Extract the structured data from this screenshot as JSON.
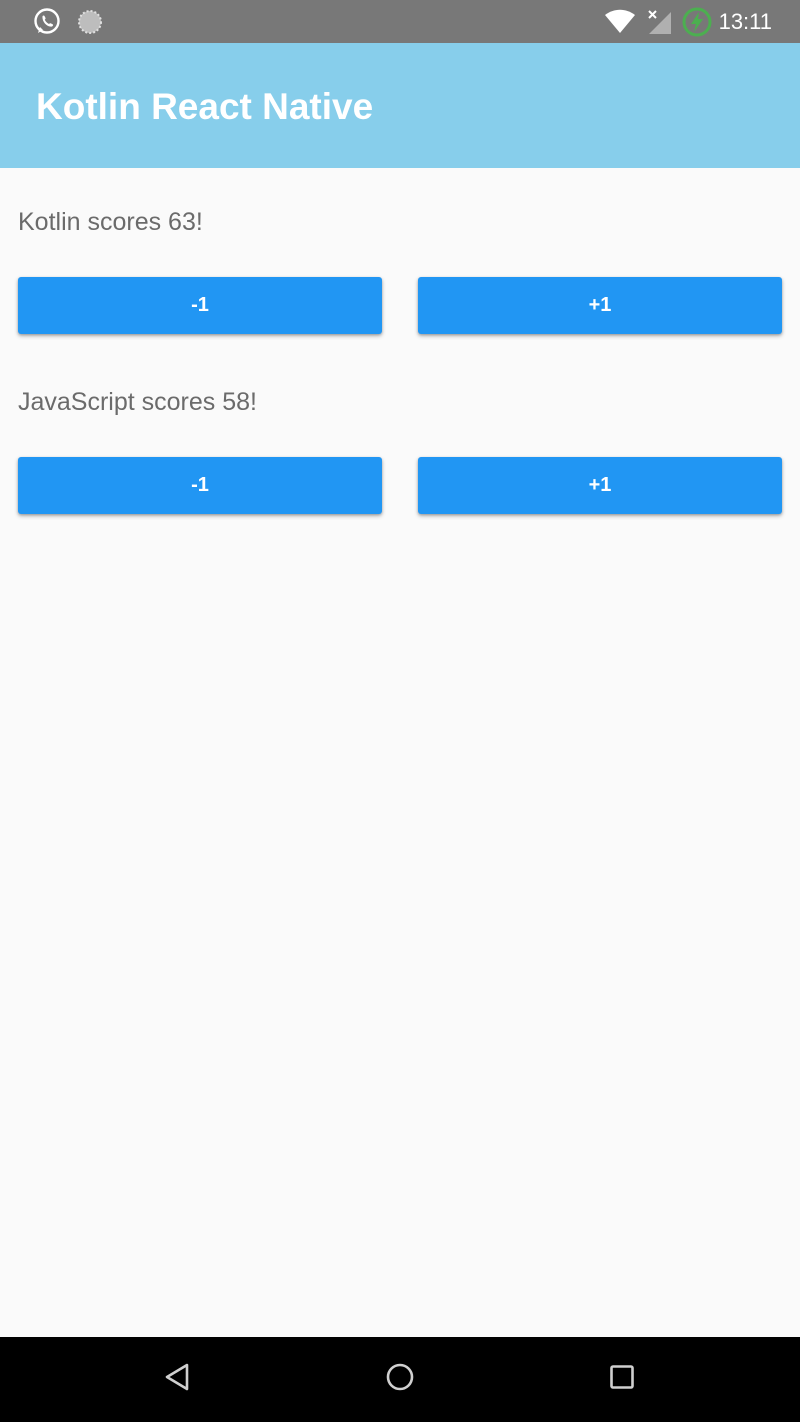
{
  "status_bar": {
    "time": "13:11",
    "icons": [
      "whatsapp-icon",
      "sync-icon",
      "wifi-icon",
      "no-signal-icon",
      "battery-charging-icon"
    ],
    "battery_color": "#4caf50"
  },
  "app_bar": {
    "title": "Kotlin React Native",
    "color": "#87ceeb"
  },
  "scores": [
    {
      "text": "Kotlin scores 63!",
      "minus_label": "-1",
      "plus_label": "+1"
    },
    {
      "text": "JavaScript scores 58!",
      "minus_label": "-1",
      "plus_label": "+1"
    }
  ],
  "colors": {
    "button": "#2196f3",
    "text": "#6b6b6b",
    "background": "#fafafa"
  },
  "nav_bar": {
    "icons": [
      "back-icon",
      "home-icon",
      "recents-icon"
    ]
  }
}
